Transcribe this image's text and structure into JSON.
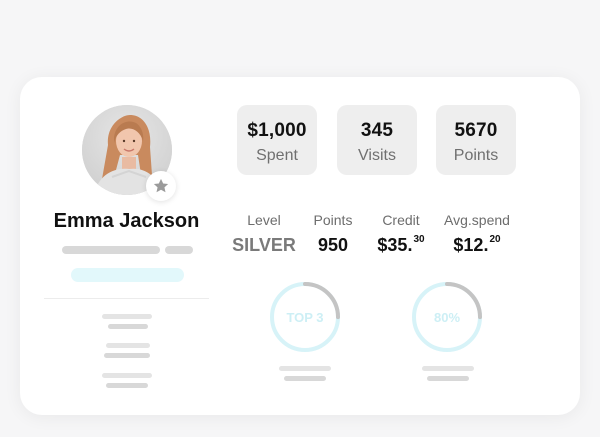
{
  "profile": {
    "name": "Emma Jackson",
    "badge_icon": "star-icon"
  },
  "stats": [
    {
      "value": "$1,000",
      "label": "Spent"
    },
    {
      "value": "345",
      "label": "Visits"
    },
    {
      "value": "5670",
      "label": "Points"
    }
  ],
  "metrics": {
    "level": {
      "label": "Level",
      "value": "SILVER"
    },
    "points": {
      "label": "Points",
      "value": "950"
    },
    "credit": {
      "label": "Credit",
      "value": "$35.",
      "cents": "30"
    },
    "avg": {
      "label": "Avg.spend",
      "value": "$12.",
      "cents": "20"
    }
  },
  "rings": [
    {
      "text": "TOP 3",
      "progress": 0.25
    },
    {
      "text": "80%",
      "progress": 0.25
    }
  ],
  "colors": {
    "ring_track": "#d7f3f8",
    "ring_progress": "#c4c4c4",
    "accent_placeholder": "#e2f8fb"
  }
}
